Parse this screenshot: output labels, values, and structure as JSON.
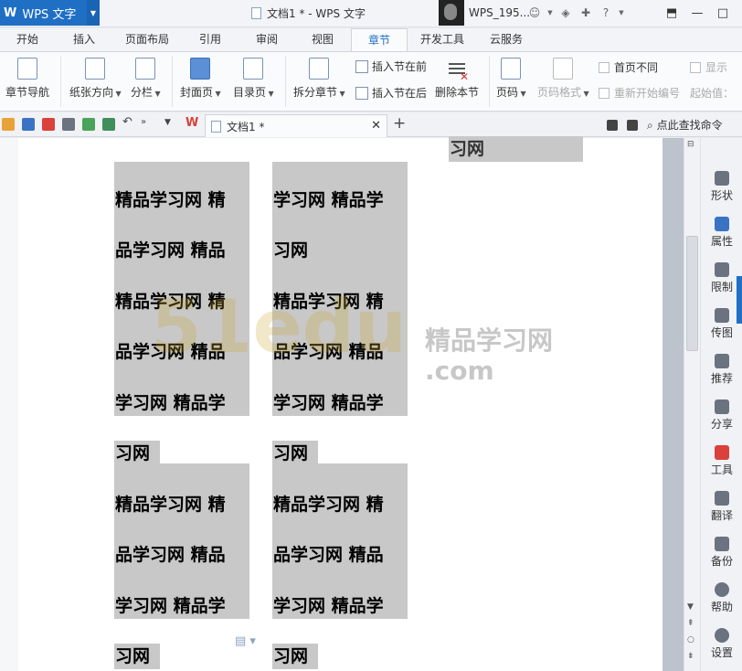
{
  "titlebar": {
    "app_name": "WPS 文字",
    "doc_title": "文档1 * - WPS 文字",
    "user_name": "WPS_195...",
    "help": "?"
  },
  "menu": {
    "tabs": [
      "开始",
      "插入",
      "页面布局",
      "引用",
      "审阅",
      "视图",
      "章节",
      "开发工具",
      "云服务"
    ],
    "active": "章节"
  },
  "ribbon": {
    "chapter_nav": "章节导航",
    "orientation": "纸张方向",
    "columns": "分栏",
    "cover": "封面页",
    "toc": "目录页",
    "split": "拆分章节",
    "insert_before": "插入节在前",
    "insert_after": "插入节在后",
    "delete_section": "删除本节",
    "page_num": "页码",
    "page_num_format": "页码格式",
    "first_diff": "首页不同",
    "restart_num": "重新开始编号",
    "start_value": "起始值：",
    "show": "显示"
  },
  "doc_tab": {
    "label": "文档1 *",
    "search": "点此查找命令"
  },
  "document": {
    "col1": [
      "精品学习网  精",
      "品学习网  精品",
      "精品学习网  精",
      "品学习网  精品",
      "学习网  精品学",
      "习网",
      "精品学习网  精",
      "品学习网  精品",
      "学习网  精品学",
      "习网"
    ],
    "col2": [
      "学习网  精品学",
      "习网",
      "精品学习网  精",
      "品学习网  精品",
      "学习网  精品学",
      "习网",
      "精品学习网  精",
      "品学习网  精品",
      "学习网  精品学",
      "习网"
    ],
    "col3_top": "习网",
    "watermark_text": "精品学习网",
    "watermark_com": ".com"
  },
  "sidepanel": [
    "形状",
    "属性",
    "限制",
    "传图",
    "推荐",
    "分享",
    "工具",
    "翻译",
    "备份",
    "帮助",
    "设置"
  ]
}
